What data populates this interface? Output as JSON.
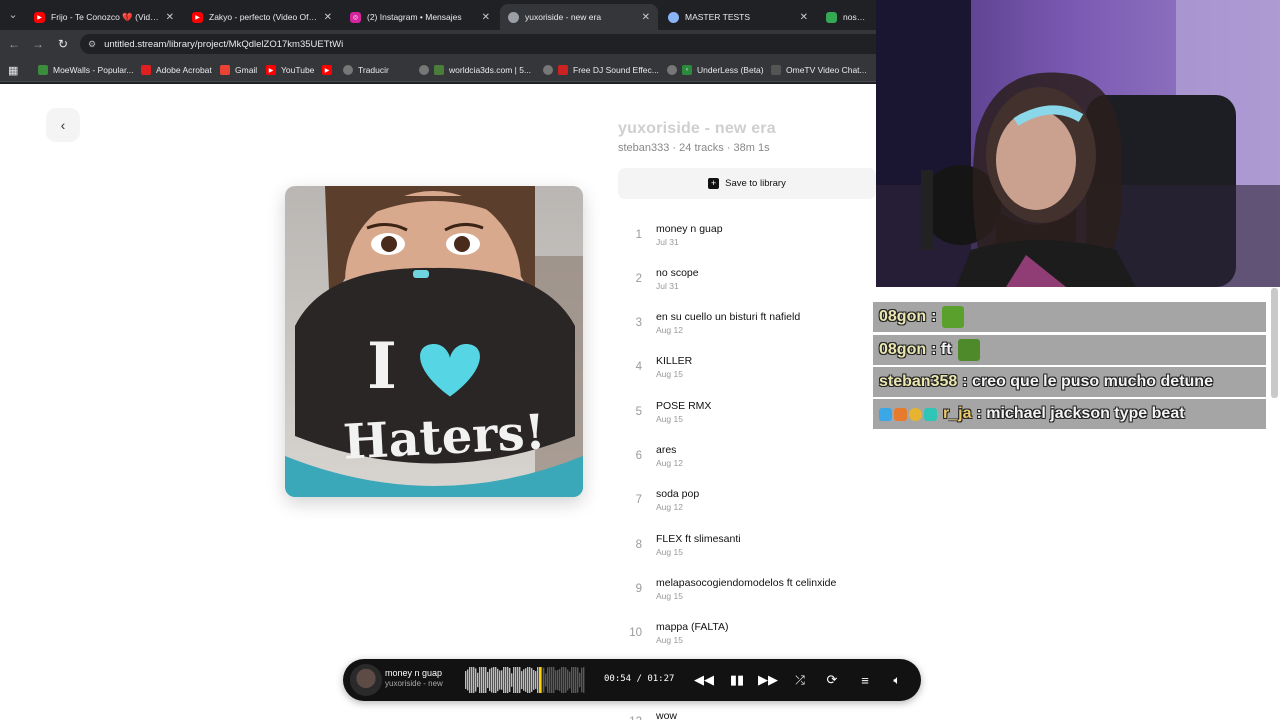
{
  "tabs": [
    {
      "label": "Frijo - Te Conozco 💔 (Video O",
      "favicon_color": "#ff0000",
      "active": false
    },
    {
      "label": "Zakyo - perfecto (Video Oficial",
      "favicon_color": "#ff0000",
      "active": false
    },
    {
      "label": "(2) Instagram • Mensajes",
      "favicon_color": "#d6249f",
      "active": false
    },
    {
      "label": "yuxoriside - new era",
      "favicon_color": "#9aa0a6",
      "active": true
    },
    {
      "label": "MASTER TESTS",
      "favicon_color": "#8ab4f8",
      "active": false
    },
    {
      "label": "nose proc",
      "favicon_color": "#34a853",
      "active": false
    }
  ],
  "address_bar": {
    "url": "untitled.stream/library/project/MkQdlelZO17km35UETtWi"
  },
  "bookmarks": [
    {
      "label": "MoeWalls - Popular...",
      "color": "#3b8d3b"
    },
    {
      "label": "Adobe Acrobat",
      "color": "#e02020"
    },
    {
      "label": "Gmail",
      "color": "#ea4335"
    },
    {
      "label": "YouTube",
      "color": "#ff0000"
    },
    {
      "label": "",
      "color": "#ff0000"
    },
    {
      "label": "Traducir",
      "color": "#777777"
    },
    {
      "label": "worldcia3ds.com | 5...",
      "color": "#777777"
    },
    {
      "label": "Free DJ Sound Effec...",
      "color": "#777777"
    },
    {
      "label": "UnderLess (Beta)",
      "color": "#777777"
    },
    {
      "label": "OmeTV Video Chat...",
      "color": "#777777"
    }
  ],
  "project": {
    "title": "yuxoriside - new era",
    "meta": "steban333 · 24 tracks · 38m 1s",
    "save_label": "Save to library"
  },
  "cover_text": {
    "line1": "I",
    "line2": "Haters!"
  },
  "tracks": [
    {
      "num": "1",
      "name": "money n guap",
      "date": "Jul 31"
    },
    {
      "num": "2",
      "name": "no scope",
      "date": "Jul 31"
    },
    {
      "num": "3",
      "name": "en su cuello un bisturi ft nafield",
      "date": "Aug 12"
    },
    {
      "num": "4",
      "name": "KILLER",
      "date": "Aug 15"
    },
    {
      "num": "5",
      "name": "POSE RMX",
      "date": "Aug 15"
    },
    {
      "num": "6",
      "name": "ares",
      "date": "Aug 12"
    },
    {
      "num": "7",
      "name": "soda pop",
      "date": "Aug 12"
    },
    {
      "num": "8",
      "name": "FLEX ft slimesanti",
      "date": "Aug 15"
    },
    {
      "num": "9",
      "name": "melapasocogiendomodelos ft celinxide",
      "date": "Aug 15"
    },
    {
      "num": "10",
      "name": "mappa (FALTA)",
      "date": "Aug 15"
    },
    {
      "num": "12",
      "name": "wow",
      "date": ""
    }
  ],
  "player": {
    "title": "money n guap",
    "artist": "yuxoriside - new",
    "time": "00:54 / 01:27",
    "progress": 0.62
  },
  "chat": [
    {
      "user": "08gon",
      "msg": ":",
      "emote": "#5aa02c"
    },
    {
      "user": "08gon",
      "msg": ": ft",
      "emote": "#4f8a2a"
    },
    {
      "user": "steban358",
      "msg": ": creo que le puso mucho detune",
      "emote": ""
    },
    {
      "user": "r_ja",
      "msg": ": michael jackson type beat",
      "emote": ""
    }
  ]
}
